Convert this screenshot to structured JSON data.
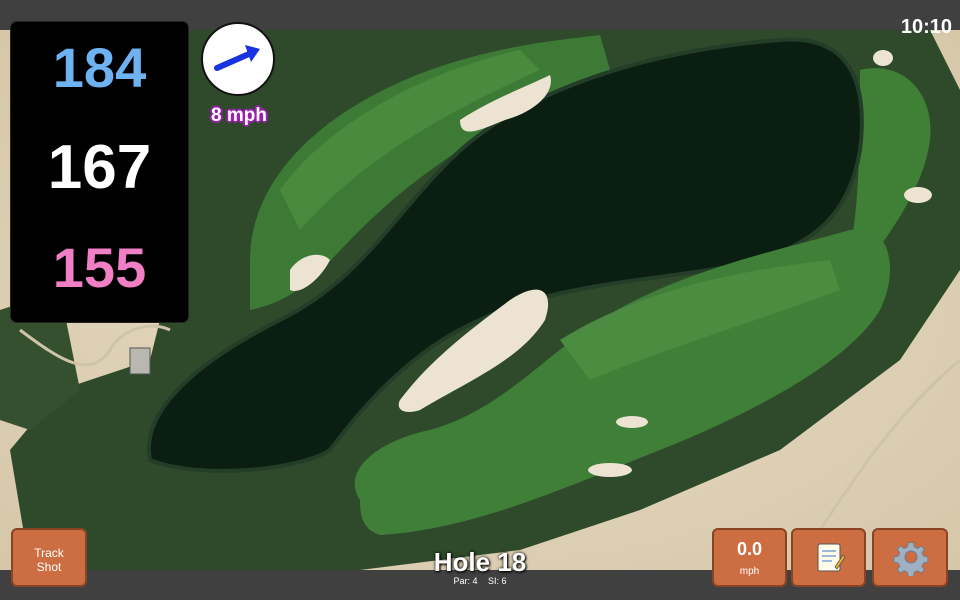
{
  "status": {
    "time": "10:10"
  },
  "yardage": {
    "back": "184",
    "middle": "167",
    "front": "155"
  },
  "wind": {
    "speed_label": "8 mph",
    "direction": "east-northeast",
    "arrow_color": "#1833e0"
  },
  "buttons": {
    "track_shot_line1": "Track",
    "track_shot_line2": "Shot",
    "speed_value": "0.0",
    "speed_unit": "mph",
    "notes_icon": "notepad-icon",
    "settings_icon": "gear-icon"
  },
  "hole": {
    "title": "Hole 18",
    "par": "Par: 4",
    "si": "SI: 6"
  },
  "colors": {
    "button": "#cc6e42",
    "back_yardage": "#6fb2f2",
    "front_yardage": "#f07fc5",
    "wind_label_outline": "#9a1fb0"
  }
}
